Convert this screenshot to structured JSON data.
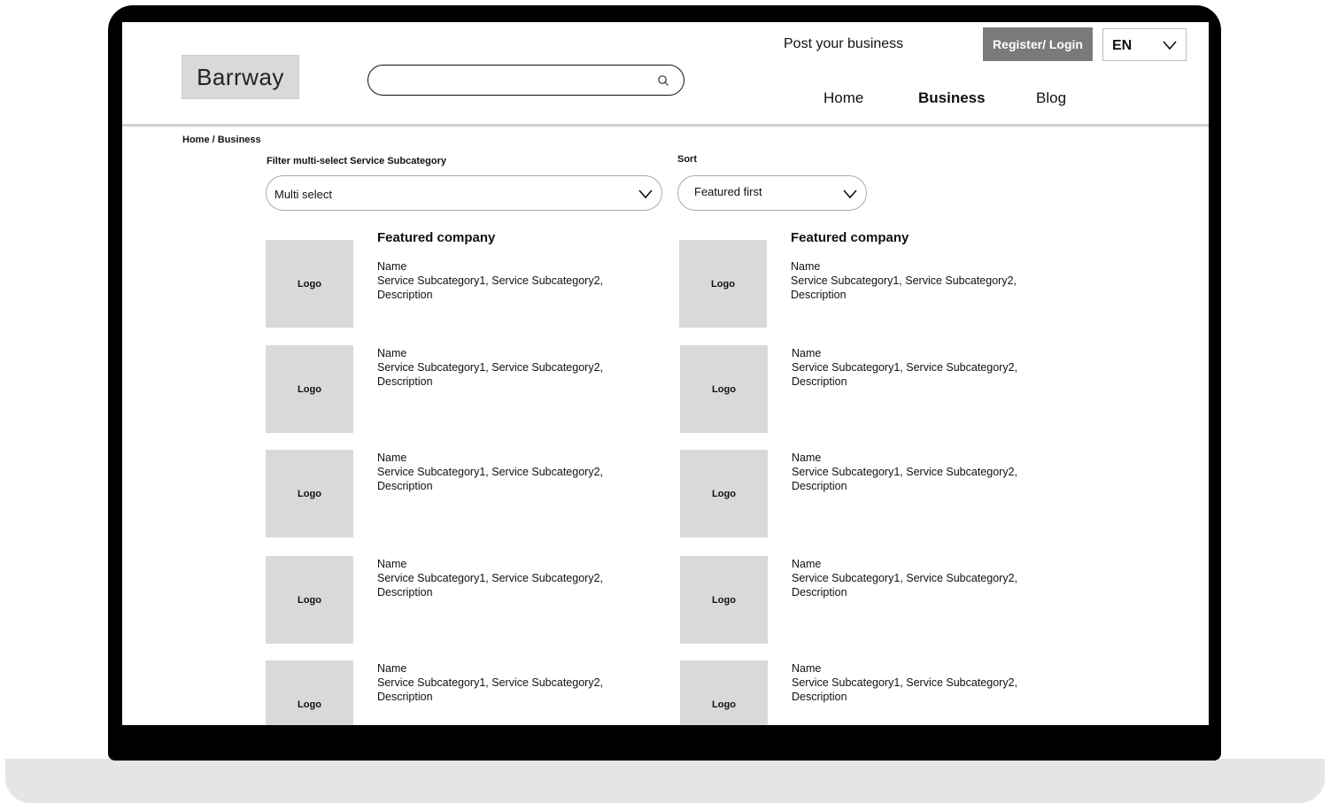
{
  "header": {
    "brand": "Barrway",
    "search": {
      "placeholder": "",
      "value": ""
    },
    "post_link": "Post your business",
    "register_label": "Register/ Login",
    "language": "EN",
    "nav": [
      "Home",
      "Business",
      "Blog"
    ]
  },
  "breadcrumb": "Home / Business",
  "filter": {
    "label": "Filter multi-select Service Subcategory",
    "value": "Multi select"
  },
  "sort": {
    "label": "Sort",
    "value": "Featured first"
  },
  "cards": [
    {
      "featured_label": "Featured company",
      "logo": "Logo",
      "name": "Name",
      "subcategories": "Service Subcategory1, Service Subcategory2,",
      "description": "Description"
    },
    {
      "featured_label": "Featured company",
      "logo": "Logo",
      "name": "Name",
      "subcategories": "Service Subcategory1, Service Subcategory2,",
      "description": "Description"
    },
    {
      "logo": "Logo",
      "name": "Name",
      "subcategories": "Service Subcategory1, Service Subcategory2,",
      "description": "Description"
    },
    {
      "logo": "Logo",
      "name": "Name",
      "subcategories": "Service Subcategory1, Service Subcategory2,",
      "description": "Description"
    },
    {
      "logo": "Logo",
      "name": "Name",
      "subcategories": "Service Subcategory1, Service Subcategory2,",
      "description": "Description"
    },
    {
      "logo": "Logo",
      "name": "Name",
      "subcategories": "Service Subcategory1, Service Subcategory2,",
      "description": "Description"
    },
    {
      "logo": "Logo",
      "name": "Name",
      "subcategories": "Service Subcategory1, Service Subcategory2,",
      "description": "Description"
    },
    {
      "logo": "Logo",
      "name": "Name",
      "subcategories": "Service Subcategory1, Service Subcategory2,",
      "description": "Description"
    },
    {
      "logo": "Logo",
      "name": "Name",
      "subcategories": "Service Subcategory1, Service Subcategory2,",
      "description": "Description"
    },
    {
      "logo": "Logo",
      "name": "Name",
      "subcategories": "Service Subcategory1, Service Subcategory2,",
      "description": "Description"
    }
  ],
  "icons": {
    "search": "search-icon",
    "chevron": "chevron-down-icon"
  },
  "colors": {
    "button_bg": "#7a7a7a",
    "placeholder_gray": "#d9d9d9",
    "frame": "#000000"
  }
}
